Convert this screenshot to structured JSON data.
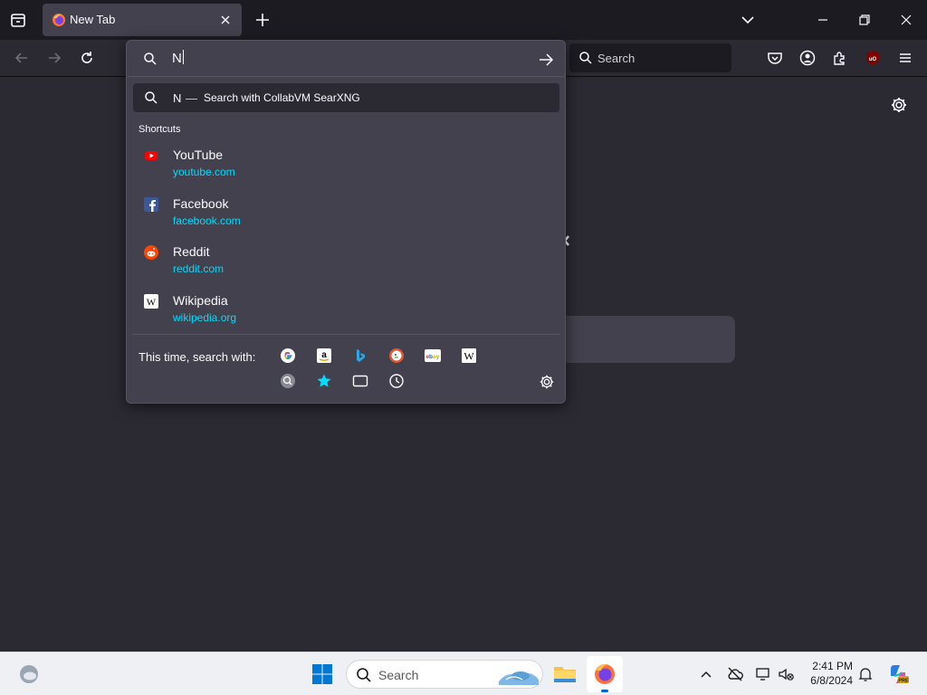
{
  "browser": {
    "tab": {
      "title": "New Tab"
    },
    "search_bar": {
      "placeholder": "Search"
    },
    "urlbar": {
      "value": "N",
      "heuristic": {
        "query": "N",
        "separator": "—",
        "action": "Search with CollabVM SearXNG"
      },
      "shortcuts_label": "Shortcuts",
      "shortcuts": [
        {
          "title": "YouTube",
          "url": "youtube.com",
          "icon": "youtube-icon",
          "color": "#ff0000"
        },
        {
          "title": "Facebook",
          "url": "facebook.com",
          "icon": "facebook-icon",
          "color": "#3b5998"
        },
        {
          "title": "Reddit",
          "url": "reddit.com",
          "icon": "reddit-icon",
          "color": "#ff4500"
        },
        {
          "title": "Wikipedia",
          "url": "wikipedia.org",
          "icon": "wikipedia-icon",
          "color": "#ffffff"
        }
      ],
      "one_off_label": "This time, search with:",
      "one_off_engines": [
        "google",
        "amazon",
        "bing",
        "duckduckgo",
        "ebay",
        "wikipedia",
        "searxng",
        "bookmarks",
        "tabs",
        "history"
      ]
    }
  },
  "taskbar": {
    "search_placeholder": "Search",
    "clock": {
      "time": "2:41 PM",
      "date": "6/8/2024"
    }
  },
  "colors": {
    "accent_link": "#00ddff",
    "panel": "#42414d",
    "background": "#2b2a33",
    "tabstrip": "#1c1b22"
  }
}
